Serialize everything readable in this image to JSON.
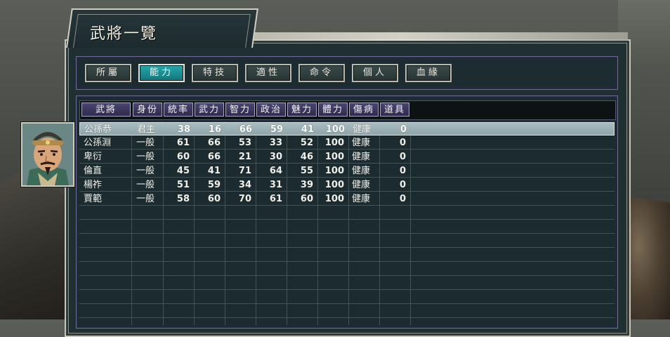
{
  "window": {
    "title": "武將一覽"
  },
  "tabs": [
    {
      "label": "所屬",
      "active": false
    },
    {
      "label": "能力",
      "active": true
    },
    {
      "label": "特技",
      "active": false
    },
    {
      "label": "適性",
      "active": false
    },
    {
      "label": "命令",
      "active": false
    },
    {
      "label": "個人",
      "active": false
    },
    {
      "label": "血緣",
      "active": false
    }
  ],
  "table": {
    "columns": [
      "武將",
      "身份",
      "統率",
      "武力",
      "智力",
      "政治",
      "魅力",
      "體力",
      "傷病",
      "道具"
    ],
    "selected_row": 0,
    "rows": [
      {
        "name": "公孫恭",
        "rank": "君主",
        "lead": "38",
        "war": "16",
        "int": "66",
        "pol": "59",
        "chr": "41",
        "hp": "100",
        "status": "健康",
        "items": "0"
      },
      {
        "name": "公孫淵",
        "rank": "一般",
        "lead": "61",
        "war": "66",
        "int": "53",
        "pol": "33",
        "chr": "52",
        "hp": "100",
        "status": "健康",
        "items": "0"
      },
      {
        "name": "卑衍",
        "rank": "一般",
        "lead": "60",
        "war": "66",
        "int": "21",
        "pol": "30",
        "chr": "46",
        "hp": "100",
        "status": "健康",
        "items": "0"
      },
      {
        "name": "倫直",
        "rank": "一般",
        "lead": "45",
        "war": "41",
        "int": "71",
        "pol": "64",
        "chr": "55",
        "hp": "100",
        "status": "健康",
        "items": "0"
      },
      {
        "name": "楊祚",
        "rank": "一般",
        "lead": "51",
        "war": "59",
        "int": "34",
        "pol": "31",
        "chr": "39",
        "hp": "100",
        "status": "健康",
        "items": "0"
      },
      {
        "name": "賈範",
        "rank": "一般",
        "lead": "58",
        "war": "60",
        "int": "70",
        "pol": "61",
        "chr": "60",
        "hp": "100",
        "status": "健康",
        "items": "0"
      }
    ]
  },
  "portrait": {
    "icon": "general-portrait"
  },
  "colors": {
    "active_tab": "#1e9ca0",
    "header_cell": "#3d3760",
    "selected_row": "#9fb3b7",
    "panel_bg": "#1f2f32"
  }
}
